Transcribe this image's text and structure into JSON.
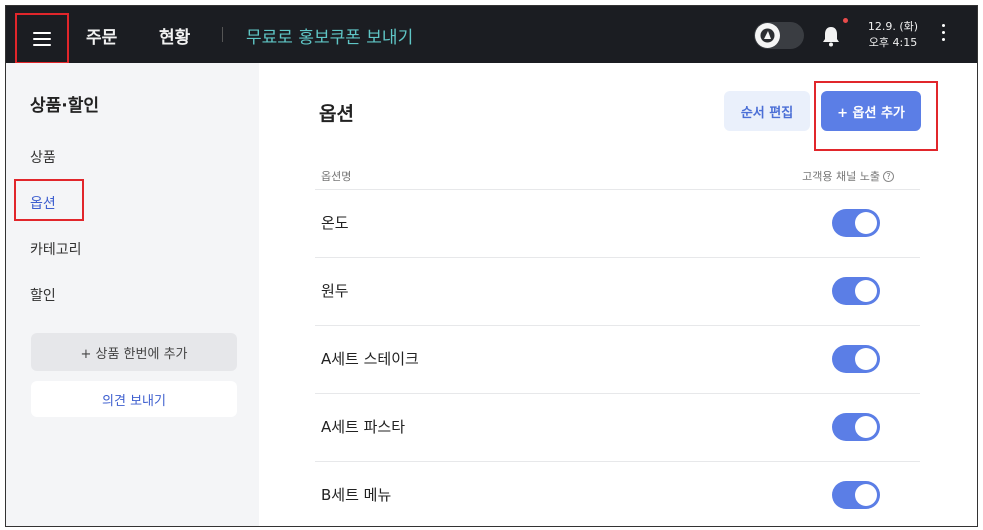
{
  "topbar": {
    "nav": [
      "주문",
      "현황"
    ],
    "coupon_link": "무료로 홍보쿠폰 보내기",
    "date": "12.9. (화)",
    "time": "오후 4:15"
  },
  "sidebar": {
    "title": "상품·할인",
    "items": [
      "상품",
      "옵션",
      "카테고리",
      "할인"
    ],
    "active": "옵션",
    "bulk_add_label": "+ 상품 한번에 추가",
    "feedback_label": "의견 보내기"
  },
  "main": {
    "title": "옵션",
    "reorder_label": "순서 편집",
    "add_label": "+ 옵션 추가",
    "table": {
      "col_name": "옵션명",
      "col_exposure": "고객용 채널 노출",
      "rows": [
        {
          "name": "온도",
          "exposed": true
        },
        {
          "name": "원두",
          "exposed": true
        },
        {
          "name": "A세트 스테이크",
          "exposed": true
        },
        {
          "name": "A세트 파스타",
          "exposed": true
        },
        {
          "name": "B세트 메뉴",
          "exposed": true
        }
      ]
    }
  },
  "colors": {
    "topbar": "#1b1d22",
    "accent": "#5b7ee6",
    "coupon": "#5fc6c6",
    "highlight_box": "#e1262b"
  },
  "icons": [
    "menu-icon",
    "theme-toggle-icon",
    "bell-icon",
    "more-vertical-icon",
    "help-circle-icon"
  ]
}
